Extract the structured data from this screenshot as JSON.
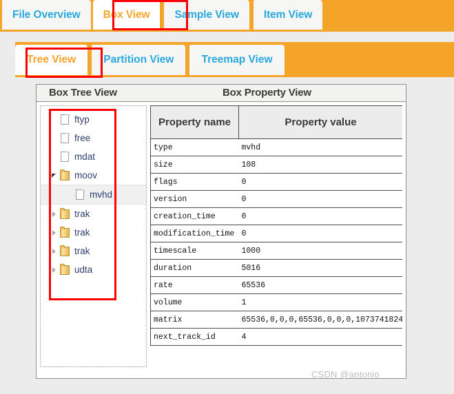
{
  "app": {
    "accent_orange": "#F5A42A",
    "tab_blue": "#29A8DD",
    "annotation_red": "#FB0000"
  },
  "tabbar_primary": {
    "items": [
      {
        "label": "File Overview",
        "active": false
      },
      {
        "label": "Box View",
        "active": true
      },
      {
        "label": "Sample View",
        "active": false
      },
      {
        "label": "Item View",
        "active": false
      }
    ]
  },
  "tabbar_secondary": {
    "items": [
      {
        "label": "Tree View",
        "active": true
      },
      {
        "label": "Partition View",
        "active": false
      },
      {
        "label": "Treemap View",
        "active": false
      }
    ]
  },
  "panels": {
    "tree_header": "Box Tree View",
    "property_header": "Box Property View"
  },
  "tree": {
    "nodes": [
      {
        "label": "ftyp",
        "icon": "file-icon",
        "indent": 0,
        "toggle": "none",
        "selected": false
      },
      {
        "label": "free",
        "icon": "file-icon",
        "indent": 0,
        "toggle": "none",
        "selected": false
      },
      {
        "label": "mdat",
        "icon": "file-icon",
        "indent": 0,
        "toggle": "none",
        "selected": false
      },
      {
        "label": "moov",
        "icon": "folder-icon",
        "indent": 0,
        "toggle": "open",
        "selected": false
      },
      {
        "label": "mvhd",
        "icon": "file-icon",
        "indent": 1,
        "toggle": "none",
        "selected": true
      },
      {
        "label": "trak",
        "icon": "folder-icon",
        "indent": 0,
        "toggle": "closed",
        "selected": false
      },
      {
        "label": "trak",
        "icon": "folder-icon",
        "indent": 0,
        "toggle": "closed",
        "selected": false
      },
      {
        "label": "trak",
        "icon": "folder-icon",
        "indent": 0,
        "toggle": "closed",
        "selected": false
      },
      {
        "label": "udta",
        "icon": "folder-icon",
        "indent": 0,
        "toggle": "closed",
        "selected": false
      }
    ]
  },
  "property_table": {
    "columns": [
      "Property name",
      "Property value"
    ],
    "rows": [
      {
        "name": "type",
        "value": "mvhd"
      },
      {
        "name": "size",
        "value": "108"
      },
      {
        "name": "flags",
        "value": "0"
      },
      {
        "name": "version",
        "value": "0"
      },
      {
        "name": "creation_time",
        "value": "0"
      },
      {
        "name": "modification_time",
        "value": "0"
      },
      {
        "name": "timescale",
        "value": "1000"
      },
      {
        "name": "duration",
        "value": "5016"
      },
      {
        "name": "rate",
        "value": "65536"
      },
      {
        "name": "volume",
        "value": "1"
      },
      {
        "name": "matrix",
        "value": "65536,0,0,0,65536,0,0,0,1073741824"
      },
      {
        "name": "next_track_id",
        "value": "4"
      }
    ]
  },
  "watermark": {
    "text": "CSDN @antonio"
  }
}
